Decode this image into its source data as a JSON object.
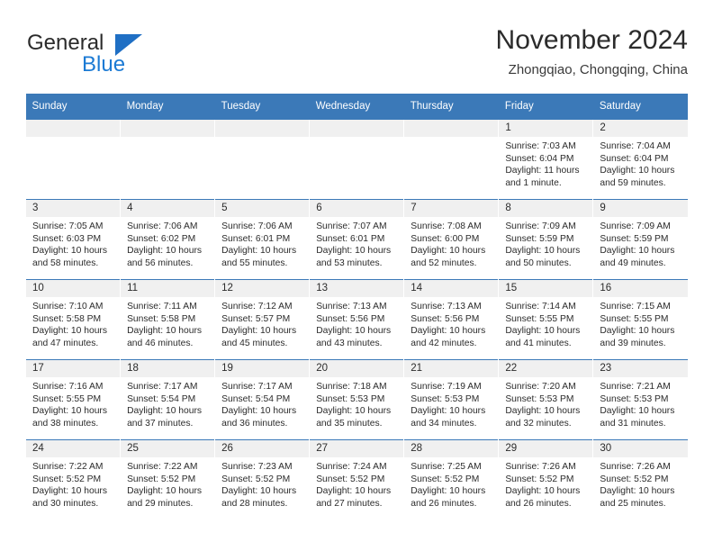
{
  "brand": {
    "name_top": "General",
    "name_bottom": "Blue",
    "accent_color": "#1b7ad4",
    "header_color": "#3b79b8"
  },
  "header": {
    "title": "November 2024",
    "subtitle": "Zhongqiao, Chongqing, China"
  },
  "calendar": {
    "weekday_headers": [
      "Sunday",
      "Monday",
      "Tuesday",
      "Wednesday",
      "Thursday",
      "Friday",
      "Saturday"
    ],
    "weeks": [
      [
        {
          "empty": true
        },
        {
          "empty": true
        },
        {
          "empty": true
        },
        {
          "empty": true
        },
        {
          "empty": true
        },
        {
          "day": "1",
          "sunrise": "Sunrise: 7:03 AM",
          "sunset": "Sunset: 6:04 PM",
          "daylight_line1": "Daylight: 11 hours",
          "daylight_line2": "and 1 minute."
        },
        {
          "day": "2",
          "sunrise": "Sunrise: 7:04 AM",
          "sunset": "Sunset: 6:04 PM",
          "daylight_line1": "Daylight: 10 hours",
          "daylight_line2": "and 59 minutes."
        }
      ],
      [
        {
          "day": "3",
          "sunrise": "Sunrise: 7:05 AM",
          "sunset": "Sunset: 6:03 PM",
          "daylight_line1": "Daylight: 10 hours",
          "daylight_line2": "and 58 minutes."
        },
        {
          "day": "4",
          "sunrise": "Sunrise: 7:06 AM",
          "sunset": "Sunset: 6:02 PM",
          "daylight_line1": "Daylight: 10 hours",
          "daylight_line2": "and 56 minutes."
        },
        {
          "day": "5",
          "sunrise": "Sunrise: 7:06 AM",
          "sunset": "Sunset: 6:01 PM",
          "daylight_line1": "Daylight: 10 hours",
          "daylight_line2": "and 55 minutes."
        },
        {
          "day": "6",
          "sunrise": "Sunrise: 7:07 AM",
          "sunset": "Sunset: 6:01 PM",
          "daylight_line1": "Daylight: 10 hours",
          "daylight_line2": "and 53 minutes."
        },
        {
          "day": "7",
          "sunrise": "Sunrise: 7:08 AM",
          "sunset": "Sunset: 6:00 PM",
          "daylight_line1": "Daylight: 10 hours",
          "daylight_line2": "and 52 minutes."
        },
        {
          "day": "8",
          "sunrise": "Sunrise: 7:09 AM",
          "sunset": "Sunset: 5:59 PM",
          "daylight_line1": "Daylight: 10 hours",
          "daylight_line2": "and 50 minutes."
        },
        {
          "day": "9",
          "sunrise": "Sunrise: 7:09 AM",
          "sunset": "Sunset: 5:59 PM",
          "daylight_line1": "Daylight: 10 hours",
          "daylight_line2": "and 49 minutes."
        }
      ],
      [
        {
          "day": "10",
          "sunrise": "Sunrise: 7:10 AM",
          "sunset": "Sunset: 5:58 PM",
          "daylight_line1": "Daylight: 10 hours",
          "daylight_line2": "and 47 minutes."
        },
        {
          "day": "11",
          "sunrise": "Sunrise: 7:11 AM",
          "sunset": "Sunset: 5:58 PM",
          "daylight_line1": "Daylight: 10 hours",
          "daylight_line2": "and 46 minutes."
        },
        {
          "day": "12",
          "sunrise": "Sunrise: 7:12 AM",
          "sunset": "Sunset: 5:57 PM",
          "daylight_line1": "Daylight: 10 hours",
          "daylight_line2": "and 45 minutes."
        },
        {
          "day": "13",
          "sunrise": "Sunrise: 7:13 AM",
          "sunset": "Sunset: 5:56 PM",
          "daylight_line1": "Daylight: 10 hours",
          "daylight_line2": "and 43 minutes."
        },
        {
          "day": "14",
          "sunrise": "Sunrise: 7:13 AM",
          "sunset": "Sunset: 5:56 PM",
          "daylight_line1": "Daylight: 10 hours",
          "daylight_line2": "and 42 minutes."
        },
        {
          "day": "15",
          "sunrise": "Sunrise: 7:14 AM",
          "sunset": "Sunset: 5:55 PM",
          "daylight_line1": "Daylight: 10 hours",
          "daylight_line2": "and 41 minutes."
        },
        {
          "day": "16",
          "sunrise": "Sunrise: 7:15 AM",
          "sunset": "Sunset: 5:55 PM",
          "daylight_line1": "Daylight: 10 hours",
          "daylight_line2": "and 39 minutes."
        }
      ],
      [
        {
          "day": "17",
          "sunrise": "Sunrise: 7:16 AM",
          "sunset": "Sunset: 5:55 PM",
          "daylight_line1": "Daylight: 10 hours",
          "daylight_line2": "and 38 minutes."
        },
        {
          "day": "18",
          "sunrise": "Sunrise: 7:17 AM",
          "sunset": "Sunset: 5:54 PM",
          "daylight_line1": "Daylight: 10 hours",
          "daylight_line2": "and 37 minutes."
        },
        {
          "day": "19",
          "sunrise": "Sunrise: 7:17 AM",
          "sunset": "Sunset: 5:54 PM",
          "daylight_line1": "Daylight: 10 hours",
          "daylight_line2": "and 36 minutes."
        },
        {
          "day": "20",
          "sunrise": "Sunrise: 7:18 AM",
          "sunset": "Sunset: 5:53 PM",
          "daylight_line1": "Daylight: 10 hours",
          "daylight_line2": "and 35 minutes."
        },
        {
          "day": "21",
          "sunrise": "Sunrise: 7:19 AM",
          "sunset": "Sunset: 5:53 PM",
          "daylight_line1": "Daylight: 10 hours",
          "daylight_line2": "and 34 minutes."
        },
        {
          "day": "22",
          "sunrise": "Sunrise: 7:20 AM",
          "sunset": "Sunset: 5:53 PM",
          "daylight_line1": "Daylight: 10 hours",
          "daylight_line2": "and 32 minutes."
        },
        {
          "day": "23",
          "sunrise": "Sunrise: 7:21 AM",
          "sunset": "Sunset: 5:53 PM",
          "daylight_line1": "Daylight: 10 hours",
          "daylight_line2": "and 31 minutes."
        }
      ],
      [
        {
          "day": "24",
          "sunrise": "Sunrise: 7:22 AM",
          "sunset": "Sunset: 5:52 PM",
          "daylight_line1": "Daylight: 10 hours",
          "daylight_line2": "and 30 minutes."
        },
        {
          "day": "25",
          "sunrise": "Sunrise: 7:22 AM",
          "sunset": "Sunset: 5:52 PM",
          "daylight_line1": "Daylight: 10 hours",
          "daylight_line2": "and 29 minutes."
        },
        {
          "day": "26",
          "sunrise": "Sunrise: 7:23 AM",
          "sunset": "Sunset: 5:52 PM",
          "daylight_line1": "Daylight: 10 hours",
          "daylight_line2": "and 28 minutes."
        },
        {
          "day": "27",
          "sunrise": "Sunrise: 7:24 AM",
          "sunset": "Sunset: 5:52 PM",
          "daylight_line1": "Daylight: 10 hours",
          "daylight_line2": "and 27 minutes."
        },
        {
          "day": "28",
          "sunrise": "Sunrise: 7:25 AM",
          "sunset": "Sunset: 5:52 PM",
          "daylight_line1": "Daylight: 10 hours",
          "daylight_line2": "and 26 minutes."
        },
        {
          "day": "29",
          "sunrise": "Sunrise: 7:26 AM",
          "sunset": "Sunset: 5:52 PM",
          "daylight_line1": "Daylight: 10 hours",
          "daylight_line2": "and 26 minutes."
        },
        {
          "day": "30",
          "sunrise": "Sunrise: 7:26 AM",
          "sunset": "Sunset: 5:52 PM",
          "daylight_line1": "Daylight: 10 hours",
          "daylight_line2": "and 25 minutes."
        }
      ]
    ]
  }
}
